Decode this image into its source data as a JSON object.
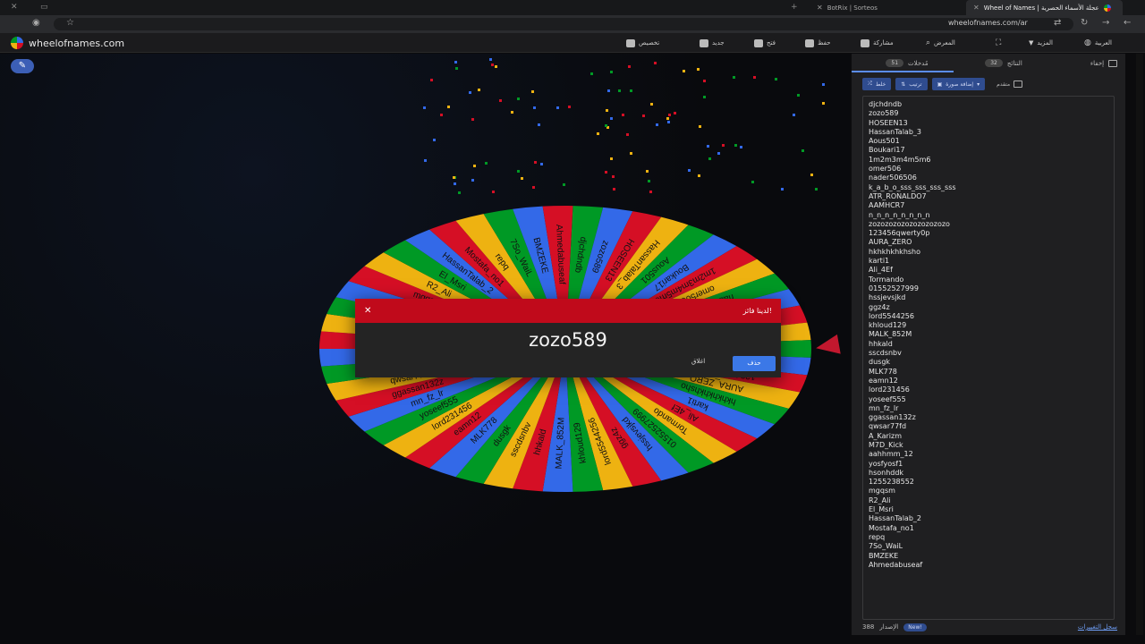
{
  "browser": {
    "tabs": [
      {
        "title": "BotRix | Sorteos",
        "active": false
      },
      {
        "title": "Wheel of Names | عجلة الأسماء الحصرية",
        "active": true
      }
    ],
    "url": "wheelofnames.com/ar"
  },
  "site": {
    "logo_text": "wheelofnames.com",
    "nav": [
      {
        "label": "العربية",
        "icon": "globe-icon"
      },
      {
        "label": "المزيد",
        "icon": "chevron-down-icon"
      },
      {
        "label": "",
        "icon": "fullscreen-icon"
      },
      {
        "label": "المعرض",
        "icon": "search-icon"
      },
      {
        "label": "مشاركة",
        "icon": "share-icon"
      },
      {
        "label": "حفظ",
        "icon": "save-icon"
      },
      {
        "label": "فتح",
        "icon": "folder-icon"
      },
      {
        "label": "جديد",
        "icon": "file-icon"
      },
      {
        "label": "تخصيص",
        "icon": "palette-icon"
      }
    ]
  },
  "dialog": {
    "title": "لدينا فائز!",
    "winner": "zozo589",
    "close_label": "اغلاق",
    "remove_label": "حذف"
  },
  "panel": {
    "tabs": [
      {
        "label": "مُدخلات",
        "count": "51",
        "active": true
      },
      {
        "label": "النتائج",
        "count": "32",
        "active": false
      },
      {
        "label": "إخفاء",
        "count": "",
        "active": false
      }
    ],
    "tools": {
      "shuffle": "خلط",
      "sort": "ترتيب",
      "add_image": "إضافة صورة",
      "advanced": "متقدم"
    },
    "entries": [
      "djchdndb",
      "zozo589",
      "HOSEEN13",
      "HassanTalab_3",
      "Aous501",
      "Boukari17",
      "1m2m3m4m5m6",
      "omer506",
      "nader506506",
      "k_a_b_o_sss_sss_sss_sss",
      "ATR_RONALDO7",
      "AAMHCR7",
      "n_n_n_n_n_n_n_n",
      "zozozozozozozozozozo",
      "123456qwerty0p",
      "AURA_ZERO",
      "hkhkhkhkhsho",
      "karti1",
      "Ali_4Ef",
      "Tormando",
      "01552527999",
      "hssjevsjkd",
      "ggz4z",
      "lord5544256",
      "khloud129",
      "MALK_852M",
      "hhkald",
      "sscdsnbv",
      "dusgk",
      "MLK778",
      "eamn12",
      "lord231456",
      "yoseef555",
      "mn_fz_lr",
      "ggassan132z",
      "qwsar77fd",
      "A_Karizm",
      "M7D_Kick",
      "aahhmm_12",
      "yosfyosf1",
      "hsonhddk",
      "1255238552",
      "mgqsm",
      "R2_Ali",
      "El_Msri",
      "HassanTalab_2",
      "Mostafa_no1",
      "repq",
      "7So_WaiL",
      "BMZEKE",
      "Ahmedabuseaf"
    ],
    "footer": {
      "version_label": "الإصدار",
      "version": "388",
      "badge": "New!",
      "changelog": "سجل التغييرات"
    }
  },
  "wheel_labels": [
    "djchdndb",
    "zozo589",
    "HOSEEN13",
    "HassanTalab_3",
    "Aous501",
    "Boukari17",
    "1m2m3m4m5m6",
    "omer506",
    "nader506506",
    "k_a_b_o_sss_sss_s",
    "ATR_RONALDO7",
    "AAMHCR7",
    "n_n_n_n_n_n_n",
    "zozozozozozozozo",
    "123456qwerty0p",
    "AURA_ZERO",
    "hkhkhkhkhsho",
    "karti1",
    "Ali_4Ef",
    "Tormando",
    "01552527999",
    "hssjevsjkd",
    "ggz4z",
    "lord5544256",
    "khloud129",
    "MALK_852M",
    "hhkald",
    "sscdsnbv",
    "dusgk",
    "MLK778",
    "eamn12",
    "lord231456",
    "yoseef555",
    "mn_fz_lr",
    "ggassan132z",
    "qwsar77fd",
    "A_Karizm",
    "M7D_Kick",
    "aahhmm_12",
    "yosfyosf1",
    "hsonhddk",
    "1255238552",
    "mgqsm",
    "R2_Ali",
    "El_Msri",
    "HassanTalab_2",
    "Mostafa_no1",
    "repq",
    "7So_WaiL",
    "BMZEKE",
    "Ahmedabuseaf"
  ],
  "colors": {
    "red": "#d50f25",
    "blue": "#3369e8",
    "yellow": "#eeb211",
    "green": "#009925",
    "accent": "#3b78e7"
  }
}
